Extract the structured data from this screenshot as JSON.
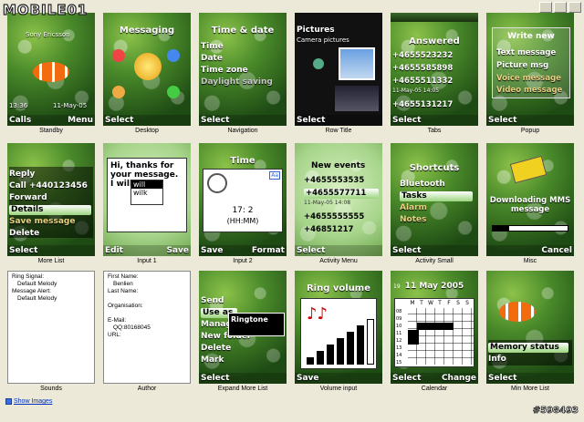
{
  "watermark": "MOBILE01",
  "copyright": "#598493",
  "footer": {
    "show_images": "Show Images"
  },
  "cells": {
    "standby": {
      "caption": "Standby",
      "operator": "Sony Ericsson",
      "time": "13:36",
      "date": "11-May-05",
      "left": "Calls",
      "right": "Menu"
    },
    "desktop": {
      "caption": "Desktop",
      "title": "Messaging",
      "left": "Select"
    },
    "navigation": {
      "caption": "Navigation",
      "title": "Time & date",
      "items": [
        "Time",
        "Date",
        "Time zone",
        "Daylight saving"
      ],
      "left": "Select"
    },
    "rowtitle": {
      "caption": "Row Title",
      "title": "Pictures",
      "subtitle": "Camera pictures",
      "left": "Select"
    },
    "tabs": {
      "caption": "Tabs",
      "title": "Answered",
      "numbers": [
        "+4655523232",
        "+4655585898",
        "+4655511332",
        "+4655131217"
      ],
      "timestamp": "11-May-05  14:05",
      "left": "Select"
    },
    "popup": {
      "caption": "Popup",
      "title": "Write new",
      "items": [
        "Text message",
        "Picture msg",
        "Voice message",
        "Video message"
      ],
      "left": "Select"
    },
    "morelist": {
      "caption": "More List",
      "items": [
        "Reply",
        "Call +440123456",
        "Forward",
        "Details",
        "Save message",
        "Delete"
      ],
      "left": "Select"
    },
    "input1": {
      "caption": "Input 1",
      "text": "Hi, thanks for your message. I will",
      "suggestions": [
        "will",
        "wilk"
      ],
      "left": "Edit",
      "right": "Save"
    },
    "input2": {
      "caption": "Input 2",
      "title": "Time",
      "badge": "Aa",
      "time": "17:  2",
      "format": "(HH:MM)",
      "left": "Save",
      "right": "Format"
    },
    "activitymenu": {
      "caption": "Activity Menu",
      "title": "New events",
      "numbers": [
        "+4655553535",
        "+4655577711",
        "+4655555555",
        "+46851217"
      ],
      "timestamp": "11-May-05  14:08",
      "left": "Select"
    },
    "activitysmall": {
      "caption": "Activity Small",
      "title": "Shortcuts",
      "items": [
        "Bluetooth",
        "Tasks",
        "Alarm",
        "Notes"
      ],
      "left": "Select"
    },
    "misc": {
      "caption": "Misc",
      "text": "Downloading MMS message",
      "right": "Cancel"
    },
    "sounds": {
      "caption": "Sounds",
      "lines": [
        "Ring Signal:",
        "Default Melody",
        "Message Alert:",
        "Default Melody"
      ]
    },
    "author": {
      "caption": "Author",
      "lines": [
        "First Name:",
        "Benlien",
        "Last Name:",
        "",
        "Organisation:",
        "",
        "E-Mail:",
        "QQ:80168045",
        "URL:"
      ]
    },
    "expandmore": {
      "caption": "Expand More List",
      "items": [
        "Send",
        "Use as",
        "Manage",
        "New folder",
        "Delete",
        "Mark"
      ],
      "submenu": "Ringtone",
      "left": "Select"
    },
    "volume": {
      "caption": "Volume input",
      "title": "Ring volume",
      "left": "Save"
    },
    "calendar": {
      "caption": "Calendar",
      "title": "11 May 2005",
      "badge": "19",
      "days": [
        "M",
        "T",
        "W",
        "T",
        "F",
        "S",
        "S"
      ],
      "hours": [
        "08",
        "09",
        "10",
        "11",
        "12",
        "13",
        "14",
        "15"
      ],
      "left": "Select",
      "right": "Change"
    },
    "minmore": {
      "caption": "Min More List",
      "items": [
        "Memory status",
        "Info"
      ],
      "left": "Select"
    }
  }
}
